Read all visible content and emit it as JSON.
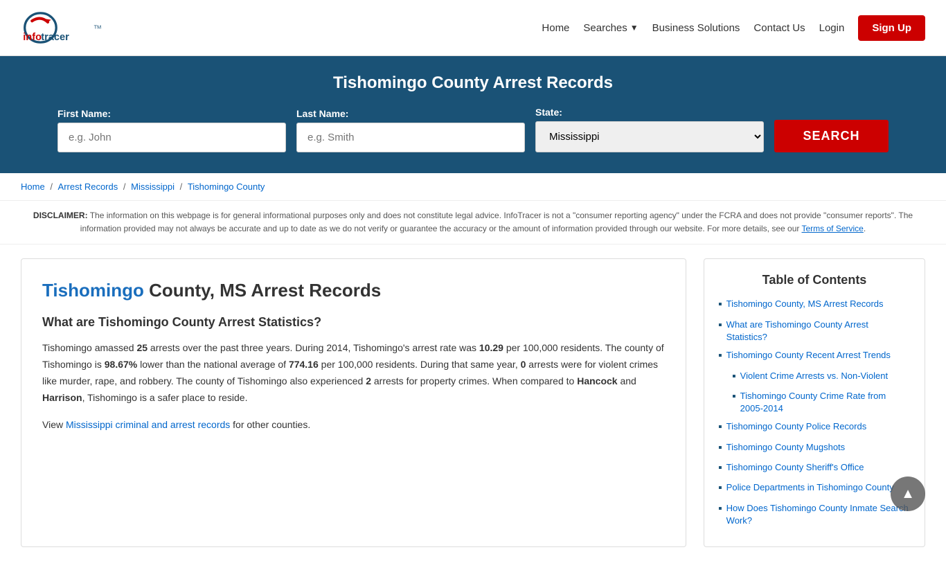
{
  "header": {
    "logo_alt": "InfoTracer",
    "nav": {
      "home": "Home",
      "searches": "Searches",
      "business_solutions": "Business Solutions",
      "contact_us": "Contact Us",
      "login": "Login",
      "signup": "Sign Up"
    }
  },
  "search_banner": {
    "title": "Tishomingo County Arrest Records",
    "first_name_label": "First Name:",
    "first_name_placeholder": "e.g. John",
    "last_name_label": "Last Name:",
    "last_name_placeholder": "e.g. Smith",
    "state_label": "State:",
    "state_value": "Mississippi",
    "search_button": "SEARCH"
  },
  "breadcrumb": {
    "home": "Home",
    "arrest_records": "Arrest Records",
    "mississippi": "Mississippi",
    "tishomingo": "Tishomingo County"
  },
  "disclaimer": {
    "label": "DISCLAIMER:",
    "text": "The information on this webpage is for general informational purposes only and does not constitute legal advice. InfoTracer is not a \"consumer reporting agency\" under the FCRA and does not provide \"consumer reports\". The information provided may not always be accurate and up to date as we do not verify or guarantee the accuracy or the amount of information provided through our website. For more details, see our",
    "tos_link": "Terms of Service",
    "period": "."
  },
  "main": {
    "heading_highlight": "Tishomingo",
    "heading_rest": " County, MS Arrest Records",
    "stats_heading": "What are Tishomingo County Arrest Statistics?",
    "paragraph1_before_25": "Tishomingo amassed ",
    "num_25": "25",
    "paragraph1_mid": " arrests over the past three years. During 2014, Tishomingo's arrest rate was ",
    "num_1029": "10.29",
    "paragraph1_mid2": " per 100,000 residents. The county of Tishomingo is ",
    "num_pct": "98.67%",
    "paragraph1_mid3": " lower than the national average of ",
    "num_77416": "774.16",
    "paragraph1_mid4": " per 100,000 residents. During that same year, ",
    "num_0": "0",
    "paragraph1_mid5": " arrests were for violent crimes like murder, rape, and robbery. The county of Tishomingo also experienced ",
    "num_2": "2",
    "paragraph1_mid6": " arrests for property crimes. When compared to ",
    "bold_hancock": "Hancock",
    "paragraph1_mid7": " and ",
    "bold_harrison": "Harrison",
    "paragraph1_end": ", Tishomingo is a safer place to reside.",
    "view_records_prefix": "View ",
    "view_records_link": "Mississippi criminal and arrest records",
    "view_records_suffix": " for other counties."
  },
  "toc": {
    "title": "Table of Contents",
    "items": [
      {
        "label": "Tishomingo County, MS Arrest Records",
        "sub": false
      },
      {
        "label": "What are Tishomingo County Arrest Statistics?",
        "sub": false
      },
      {
        "label": "Tishomingo County Recent Arrest Trends",
        "sub": false
      },
      {
        "label": "Violent Crime Arrests vs. Non-Violent",
        "sub": true
      },
      {
        "label": "Tishomingo County Crime Rate from 2005-2014",
        "sub": true
      },
      {
        "label": "Tishomingo County Police Records",
        "sub": false
      },
      {
        "label": "Tishomingo County Mugshots",
        "sub": false
      },
      {
        "label": "Tishomingo County Sheriff's Office",
        "sub": false
      },
      {
        "label": "Police Departments in Tishomingo County",
        "sub": false
      },
      {
        "label": "How Does Tishomingo County Inmate Search Work?",
        "sub": false
      }
    ]
  }
}
